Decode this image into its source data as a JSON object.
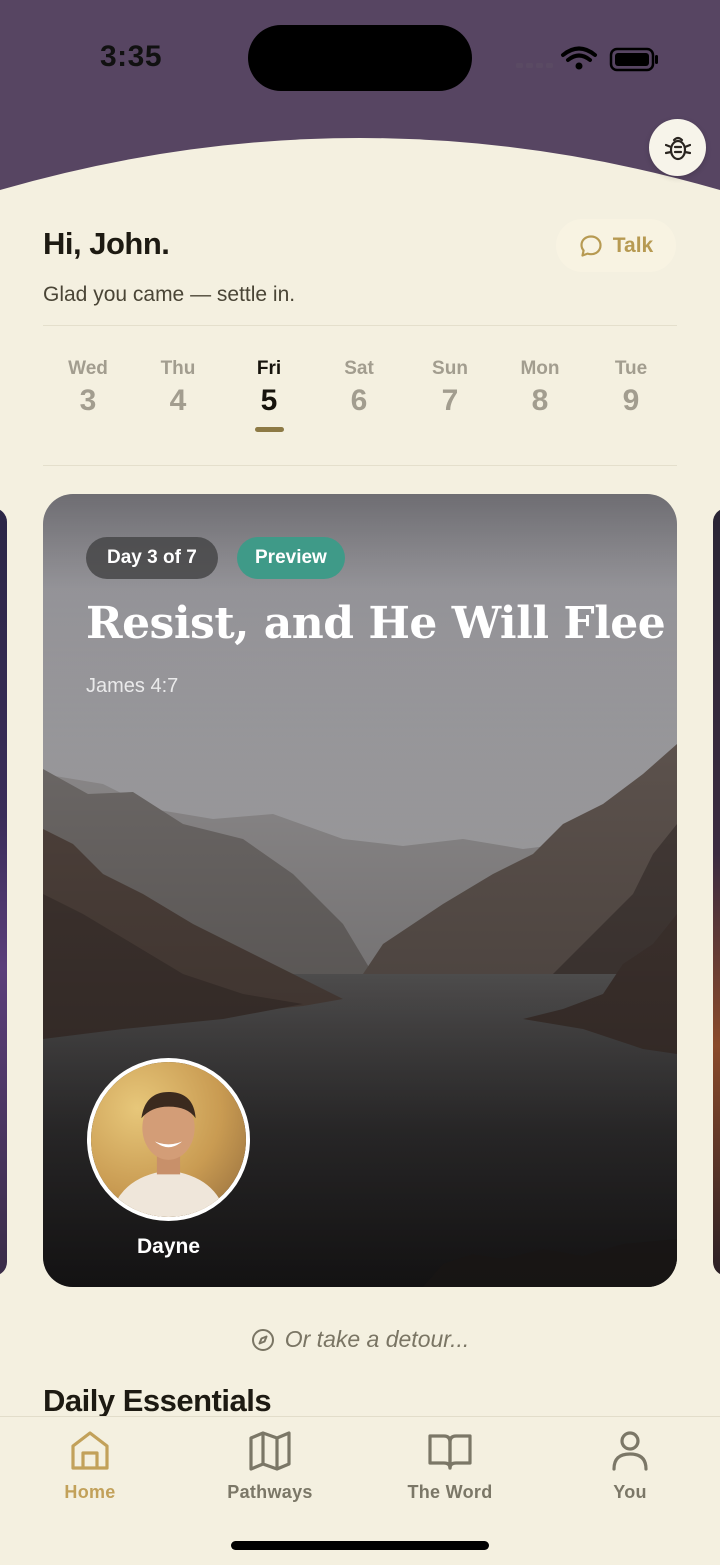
{
  "status_bar": {
    "time": "3:35"
  },
  "header": {
    "greeting": "Hi, John.",
    "subtitle": "Glad you came — settle in.",
    "talk_label": "Talk"
  },
  "week": {
    "days": [
      {
        "name": "Wed",
        "number": "3"
      },
      {
        "name": "Thu",
        "number": "4"
      },
      {
        "name": "Fri",
        "number": "5"
      },
      {
        "name": "Sat",
        "number": "6"
      },
      {
        "name": "Sun",
        "number": "7"
      },
      {
        "name": "Mon",
        "number": "8"
      },
      {
        "name": "Tue",
        "number": "9"
      }
    ],
    "selected": "Fri"
  },
  "card": {
    "day_badge": "Day 3 of 7",
    "preview_badge": "Preview",
    "title": "Resist, and He Will Flee",
    "reference": "James 4:7",
    "guide_name": "Dayne"
  },
  "detour_text": "Or take a detour...",
  "section_title": "Daily Essentials",
  "tabs": [
    {
      "label": "Home",
      "icon": "home-icon",
      "active": true
    },
    {
      "label": "Pathways",
      "icon": "map-icon",
      "active": false
    },
    {
      "label": "The Word",
      "icon": "book-icon",
      "active": false
    },
    {
      "label": "You",
      "icon": "person-icon",
      "active": false
    }
  ],
  "colors": {
    "header_purple": "#574562",
    "background_cream": "#f4f0e0",
    "accent_gold": "#c2a15a",
    "preview_green": "#3f9a88"
  }
}
